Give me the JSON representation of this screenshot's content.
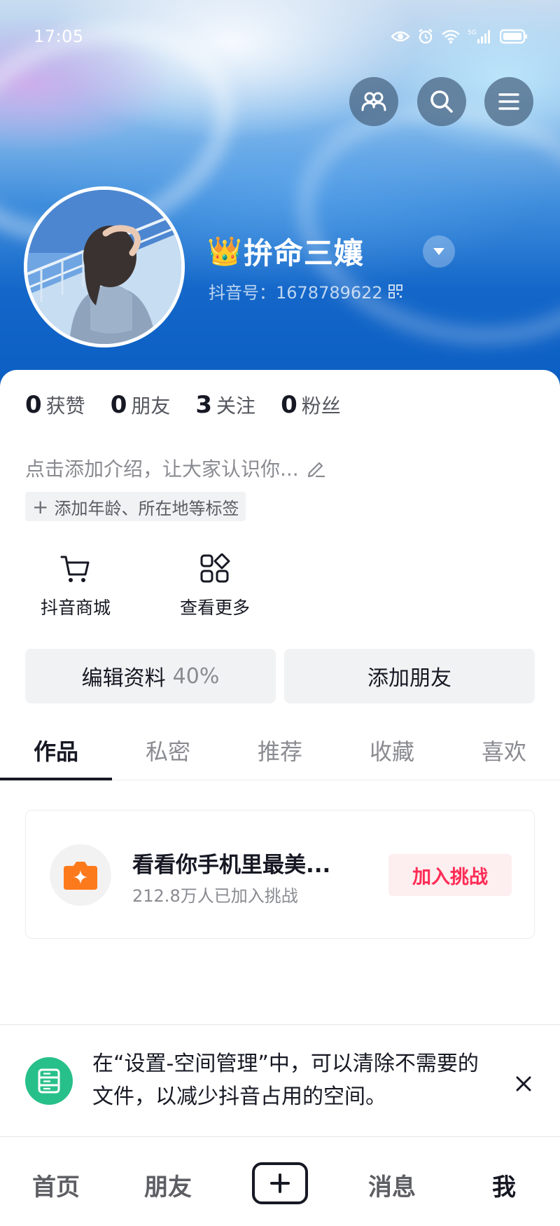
{
  "status_bar": {
    "time": "17:05",
    "network": "5G",
    "icons": [
      "eye-icon",
      "alarm-icon",
      "wifi-icon",
      "signal-icon",
      "battery-icon"
    ]
  },
  "header": {
    "buttons": [
      "friends-icon",
      "search-icon",
      "menu-icon"
    ],
    "username": "拚命三孃",
    "crown_emoji": "👑",
    "douyin_id": "抖音号：1678789622"
  },
  "stats": [
    {
      "num": "0",
      "label": "获赞"
    },
    {
      "num": "0",
      "label": "朋友"
    },
    {
      "num": "3",
      "label": "关注"
    },
    {
      "num": "0",
      "label": "粉丝"
    }
  ],
  "bio": {
    "placeholder": "点击添加介绍，让大家认识你...",
    "tag_chip": "添加年龄、所在地等标签"
  },
  "shortcuts": [
    {
      "label": "抖音商城",
      "icon": "cart-icon"
    },
    {
      "label": "查看更多",
      "icon": "grid-icon"
    }
  ],
  "actions": {
    "edit_profile": "编辑资料",
    "edit_progress": "40%",
    "add_friends": "添加朋友"
  },
  "tabs": [
    "作品",
    "私密",
    "推荐",
    "收藏",
    "喜欢"
  ],
  "active_tab": "作品",
  "challenge": {
    "title": "看看你手机里最美...",
    "subtitle": "212.8万人已加入挑战",
    "button": "加入挑战"
  },
  "notice": {
    "text": "在“设置-空间管理”中，可以清除不需要的文件，以减少抖音占用的空间。"
  },
  "bottom_nav": {
    "home": "首页",
    "friends": "朋友",
    "messages": "消息",
    "me": "我",
    "active": "我"
  },
  "colors": {
    "accent": "#fe2c55",
    "notice_icon": "#28c08a",
    "header_blue": "#0b5ec2"
  }
}
